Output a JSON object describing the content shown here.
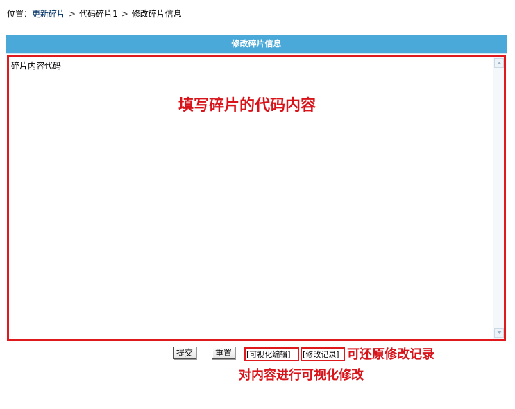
{
  "breadcrumb": {
    "label": "位置：",
    "items": [
      "更新碎片",
      "代码碎片1",
      "修改碎片信息"
    ],
    "separator": ">"
  },
  "panel": {
    "title": "修改碎片信息"
  },
  "editor": {
    "value": "碎片内容代码"
  },
  "annotations": {
    "main": "填写碎片的代码内容",
    "right": "可还原修改记录",
    "bottom": "对内容进行可视化修改"
  },
  "actions": {
    "submit_label": "提交",
    "reset_label": "重置",
    "visual_edit_label": "[可视化编辑]",
    "history_label": "[修改记录]"
  },
  "colors": {
    "header_bg": "#4aa9d8",
    "highlight_red": "#e0191d",
    "annotation_red": "#d8141b",
    "link_blue": "#003366"
  }
}
